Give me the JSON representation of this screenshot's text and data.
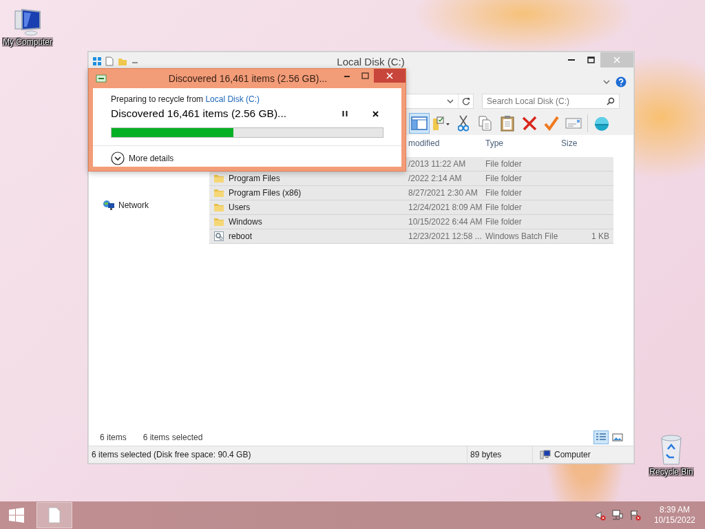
{
  "desktop_icons": [
    {
      "kind": "computer",
      "label": "My Computer"
    },
    {
      "kind": "recycle",
      "label": "Recycle Bin"
    }
  ],
  "explorer": {
    "title": "Local Disk (C:)",
    "search": {
      "placeholder": "Search Local Disk (C:)"
    },
    "preview_pane": {
      "on": true
    },
    "toolbar": [
      {
        "kind": "preview-pane"
      },
      {
        "kind": "folder-options"
      },
      {
        "kind": "cut"
      },
      {
        "kind": "copy"
      },
      {
        "kind": "paste"
      },
      {
        "kind": "delete"
      },
      {
        "kind": "check"
      },
      {
        "kind": "card"
      },
      {
        "kind": "shell"
      }
    ],
    "nav_pane": [
      {
        "kind": "network",
        "label": "Network"
      }
    ],
    "columns": [
      "modified",
      "Type",
      "Size"
    ],
    "rows": [
      {
        "date_modified": "/2013 11:22 AM",
        "type": "File folder",
        "selected": true
      },
      {
        "kind": "folder",
        "name": "Program Files",
        "date_modified": "/2022 2:14 AM",
        "type": "File folder",
        "selected": true
      },
      {
        "kind": "folder",
        "name": "Program Files (x86)",
        "date_modified": "8/27/2021 2:30 AM",
        "type": "File folder",
        "selected": true
      },
      {
        "kind": "folder",
        "name": "Users",
        "date_modified": "12/24/2021 8:09 AM",
        "type": "File folder",
        "selected": true
      },
      {
        "kind": "folder",
        "name": "Windows",
        "date_modified": "10/15/2022 6:44 AM",
        "type": "File folder",
        "selected": true
      },
      {
        "kind": "batch",
        "name": "reboot",
        "date_modified": "12/23/2021 12:58 ...",
        "type": "Windows Batch File",
        "size": "1 KB",
        "selected": true
      }
    ],
    "item_count": "6 items",
    "selection_count": "6 items selected",
    "view_buttons": [
      {
        "kind": "details",
        "selected": true
      },
      {
        "kind": "large-icons",
        "selected": false
      }
    ],
    "status_bar": {
      "summary": "6 items selected (Disk free space: 90.4 GB)",
      "size": "89 bytes",
      "location": "Computer"
    }
  },
  "dialog": {
    "title": "Discovered 16,461 items (2.56 GB)...",
    "source_prefix": "Preparing to recycle from",
    "source_link": "Local Disk (C:)",
    "heading": "Discovered 16,461 items (2.56 GB)...",
    "progress": {
      "level": 0.45
    },
    "details_toggle": {
      "label": "More details",
      "expanded": false
    }
  },
  "taskbar": {
    "clock": {
      "time": "8:39 AM",
      "date": "10/15/2022"
    }
  }
}
